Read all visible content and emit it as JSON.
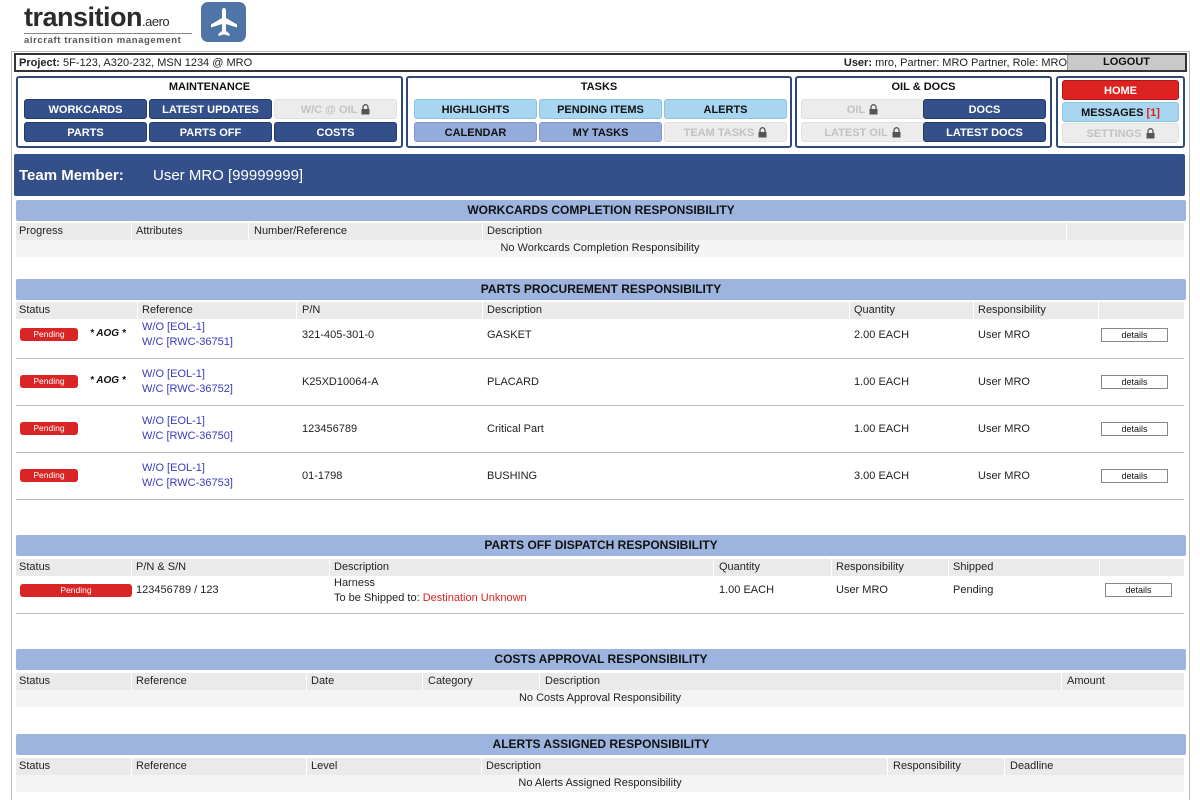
{
  "logo": {
    "wordmark": "transition",
    "wordmark_suffix": ".aero",
    "tagline": "aircraft transition management"
  },
  "project_bar": {
    "project_label": "Project:",
    "project_value": "5F-123, A320-232, MSN 1234 @ MRO",
    "user_label": "User:",
    "user_value": "mro, Partner: MRO Partner, Role: MRO",
    "logout": "LOGOUT"
  },
  "nav": {
    "maintenance": {
      "title": "MAINTENANCE",
      "workcards": "WORKCARDS",
      "latest_updates": "LATEST UPDATES",
      "wc_oil": "W/C @ OIL",
      "parts": "PARTS",
      "parts_off": "PARTS OFF",
      "costs": "COSTS"
    },
    "tasks": {
      "title": "TASKS",
      "highlights": "HIGHLIGHTS",
      "pending_items": "PENDING ITEMS",
      "alerts": "ALERTS",
      "calendar": "CALENDAR",
      "my_tasks": "MY TASKS",
      "team_tasks": "TEAM TASKS"
    },
    "oil_docs": {
      "title": "OIL & DOCS",
      "oil": "OIL",
      "docs": "DOCS",
      "latest_oil": "LATEST OIL",
      "latest_docs": "LATEST DOCS"
    },
    "home": {
      "home": "HOME",
      "messages": "MESSAGES",
      "messages_count": "[1]",
      "settings": "SETTINGS"
    }
  },
  "team": {
    "label": "Team Member:",
    "value": "User MRO [99999999]"
  },
  "workcards_section": {
    "title": "WORKCARDS COMPLETION RESPONSIBILITY",
    "columns": [
      "Progress",
      "Attributes",
      "Number/Reference",
      "Description"
    ],
    "empty": "No Workcards Completion Responsibility"
  },
  "parts_section": {
    "title": "PARTS PROCUREMENT RESPONSIBILITY",
    "columns": [
      "Status",
      "Reference",
      "P/N",
      "Description",
      "Quantity",
      "Responsibility"
    ],
    "rows": [
      {
        "status": "Pending",
        "aog": "* AOG *",
        "wo": "W/O [EOL-1]",
        "wc": "W/C [RWC-36751]",
        "pn": "321-405-301-0",
        "desc": "GASKET",
        "qty": "2.00 EACH",
        "resp": "User MRO",
        "details": "details"
      },
      {
        "status": "Pending",
        "aog": "* AOG *",
        "wo": "W/O [EOL-1]",
        "wc": "W/C [RWC-36752]",
        "pn": "K25XD10064-A",
        "desc": "PLACARD",
        "qty": "1.00 EACH",
        "resp": "User MRO",
        "details": "details"
      },
      {
        "status": "Pending",
        "aog": "",
        "wo": "W/O [EOL-1]",
        "wc": "W/C [RWC-36750]",
        "pn": "123456789",
        "desc": "Critical Part",
        "qty": "1.00 EACH",
        "resp": "User MRO",
        "details": "details"
      },
      {
        "status": "Pending",
        "aog": "",
        "wo": "W/O [EOL-1]",
        "wc": "W/C [RWC-36753]",
        "pn": "01-1798",
        "desc": "BUSHING",
        "qty": "3.00 EACH",
        "resp": "User MRO",
        "details": "details"
      }
    ]
  },
  "parts_off_section": {
    "title": "PARTS OFF DISPATCH RESPONSIBILITY",
    "columns": [
      "Status",
      "P/N & S/N",
      "Description",
      "Quantity",
      "Responsibility",
      "Shipped"
    ],
    "rows": [
      {
        "status": "Pending",
        "pnsn": "123456789 / 123",
        "desc": "Harness",
        "ship_label": "To be Shipped to:",
        "ship_dest": "Destination Unknown",
        "qty": "1.00 EACH",
        "resp": "User MRO",
        "shipped": "Pending",
        "details": "details"
      }
    ]
  },
  "costs_section": {
    "title": "COSTS APPROVAL RESPONSIBILITY",
    "columns": [
      "Status",
      "Reference",
      "Date",
      "Category",
      "Description",
      "Amount"
    ],
    "empty": "No Costs Approval Responsibility"
  },
  "alerts_section": {
    "title": "ALERTS ASSIGNED RESPONSIBILITY",
    "columns": [
      "Status",
      "Reference",
      "Level",
      "Description",
      "Responsibility",
      "Deadline"
    ],
    "empty": "No Alerts Assigned Responsibility"
  },
  "colors": {
    "navy": "#34508a",
    "light_blue": "#a8d6f0",
    "mid_blue": "#94acdc",
    "section_blue": "#9cb4de",
    "pending_red": "#d92525",
    "home_red": "#dd2222",
    "link_blue": "#3a3abe"
  }
}
